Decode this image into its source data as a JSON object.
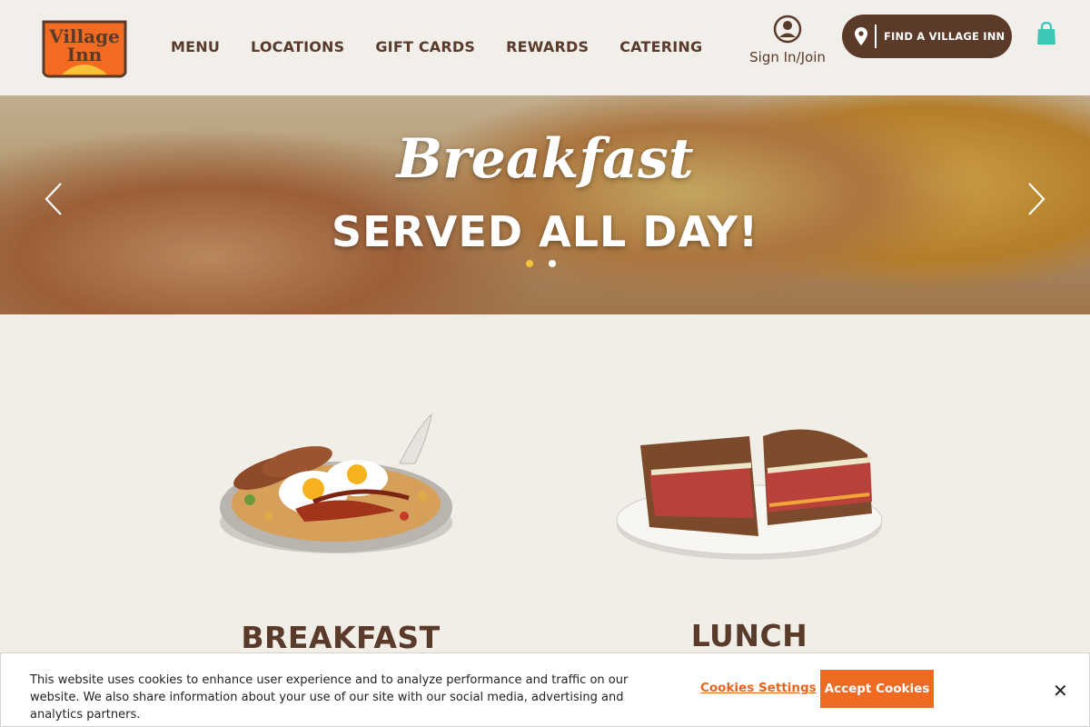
{
  "brand": {
    "logo_text_line1": "Village",
    "logo_text_line2": "Inn"
  },
  "nav": {
    "items": [
      {
        "label": "MENU"
      },
      {
        "label": "LOCATIONS"
      },
      {
        "label": "GIFT CARDS"
      },
      {
        "label": "REWARDS"
      },
      {
        "label": "CATERING"
      }
    ]
  },
  "account": {
    "sign_in_label": "Sign In/Join",
    "icon": "user-circle-icon"
  },
  "find_location": {
    "label": "FIND A VILLAGE INN",
    "icon": "map-pin-icon"
  },
  "cart": {
    "icon": "shopping-bag-icon",
    "color": "#3cc6b6"
  },
  "hero": {
    "script_text": "Breakfast",
    "headline": "SERVED ALL DAY!",
    "slide_count": 2,
    "active_slide": 1,
    "prev_icon": "chevron-left-icon",
    "next_icon": "chevron-right-icon"
  },
  "categories": [
    {
      "title": "BREAKFAST",
      "image": "skillet-breakfast-image"
    },
    {
      "title": "LUNCH",
      "image": "reuben-sandwich-image"
    }
  ],
  "cookie_banner": {
    "text": "This website uses cookies to enhance user experience and to analyze performance and traffic on our website. We also share information about your use of our site with our social media, advertising and analytics partners.",
    "settings_label": "Cookies Settings",
    "accept_label": "Accept Cookies",
    "close_icon": "close-icon"
  },
  "colors": {
    "brand_brown": "#5a3a2a",
    "accent_orange": "#f06b22",
    "background": "#f1eee8",
    "dot_active": "#f0c53a"
  }
}
